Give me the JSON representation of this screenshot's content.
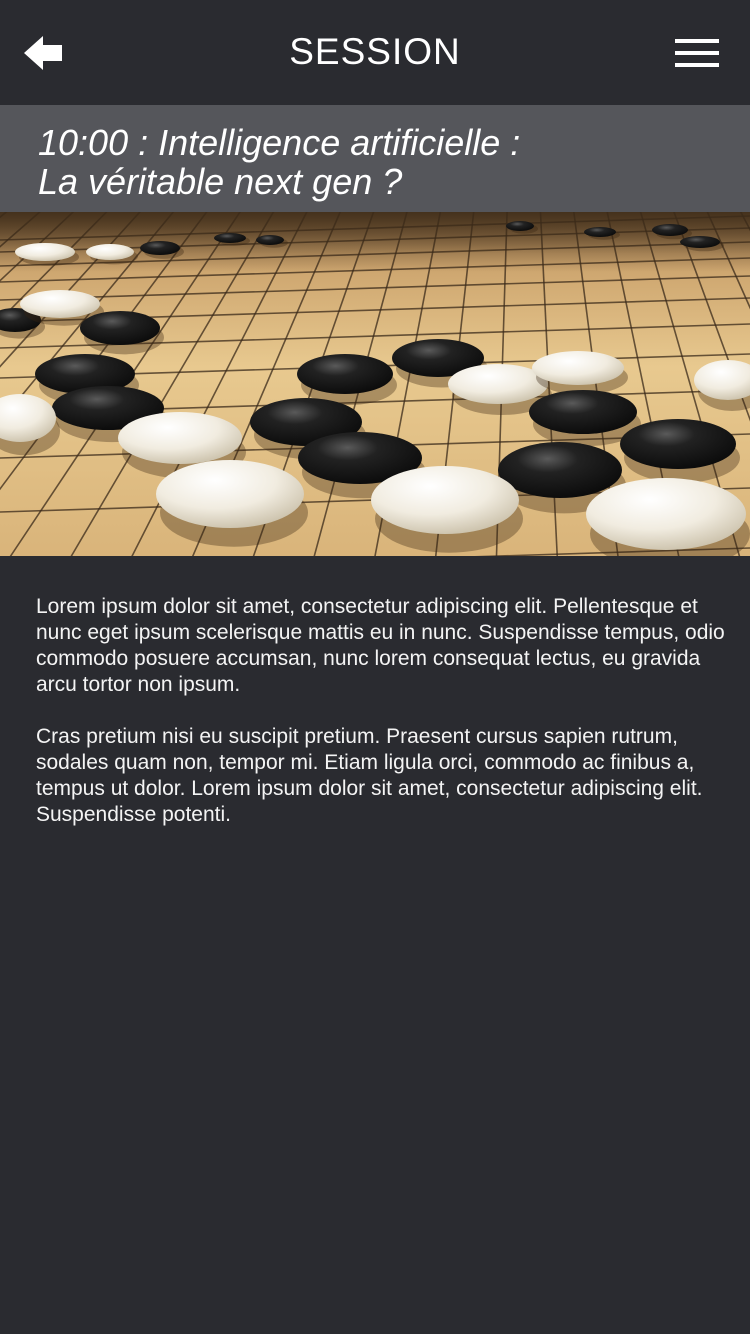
{
  "header": {
    "title": "SESSION",
    "back_icon": "back-arrow-icon",
    "menu_icon": "hamburger-menu-icon"
  },
  "session": {
    "title_line1": "10:00 : Intelligence artificielle :",
    "title_line2": "La véritable next gen ?"
  },
  "hero": {
    "subject": "go-board-photo"
  },
  "description": {
    "paragraph1": "Lorem ipsum dolor sit amet, consectetur adipiscing elit. Pellentesque et nunc eget ipsum scelerisque mattis eu in nunc. Suspendisse tempus, odio commodo posuere accumsan, nunc lorem consequat lectus, eu gravida arcu tortor non ipsum.",
    "paragraph2": "Cras pretium nisi eu suscipit pretium. Praesent cursus sapien rutrum, sodales quam non, tempor mi. Etiam ligula orci, commodo ac finibus a, tempus ut dolor. Lorem ipsum dolor sit amet, consectetur adipiscing elit. Suspendisse potenti."
  },
  "colors": {
    "background": "#2a2b30",
    "title_band": "#55565b",
    "text": "#ffffff",
    "board": "#e6c58a"
  }
}
